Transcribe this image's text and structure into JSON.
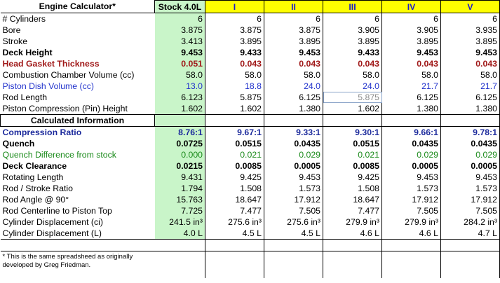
{
  "header": {
    "title": "Engine Calculator*",
    "stock": "Stock 4.0L",
    "cols": [
      "I",
      "II",
      "III",
      "IV",
      "V"
    ]
  },
  "rows": [
    {
      "label": "# Cylinders",
      "vals": [
        "6",
        "6",
        "6",
        "6",
        "6",
        "6"
      ]
    },
    {
      "label": "Bore",
      "vals": [
        "3.875",
        "3.875",
        "3.875",
        "3.905",
        "3.905",
        "3.935"
      ]
    },
    {
      "label": "Stroke",
      "vals": [
        "3.413",
        "3.895",
        "3.895",
        "3.895",
        "3.895",
        "3.895"
      ]
    },
    {
      "label": "Deck Height",
      "vals": [
        "9.453",
        "9.433",
        "9.453",
        "9.433",
        "9.453",
        "9.453"
      ]
    },
    {
      "label": "Head Gasket Thickness",
      "vals": [
        "0.051",
        "0.043",
        "0.043",
        "0.043",
        "0.043",
        "0.043"
      ]
    },
    {
      "label": "Combustion Chamber Volume (cc)",
      "vals": [
        "58.0",
        "58.0",
        "58.0",
        "58.0",
        "58.0",
        "58.0"
      ]
    },
    {
      "label": "Piston Dish Volume (cc)",
      "vals": [
        "13.0",
        "18.8",
        "24.0",
        "24.0",
        "21.7",
        "21.7"
      ]
    },
    {
      "label": "Rod Length",
      "vals": [
        "6.123",
        "5.875",
        "6.125",
        "5.875",
        "6.125",
        "6.125"
      ]
    },
    {
      "label": "Piston Compression (Pin) Height",
      "vals": [
        "1.602",
        "1.602",
        "1.380",
        "1.602",
        "1.380",
        "1.380"
      ]
    }
  ],
  "section_title": "Calculated Information",
  "calc_rows": [
    {
      "label": "Compression Ratio",
      "vals": [
        "8.76:1",
        "9.67:1",
        "9.33:1",
        "9.30:1",
        "9.66:1",
        "9.78:1"
      ]
    },
    {
      "label": "Quench",
      "vals": [
        "0.0725",
        "0.0515",
        "0.0435",
        "0.0515",
        "0.0435",
        "0.0435"
      ]
    },
    {
      "label": "Quench Difference from stock",
      "vals": [
        "0.000",
        "0.021",
        "0.029",
        "0.021",
        "0.029",
        "0.029"
      ]
    },
    {
      "label": "Deck Clearance",
      "vals": [
        "0.0215",
        "0.0085",
        "0.0005",
        "0.0085",
        "0.0005",
        "0.0005"
      ]
    },
    {
      "label": "Rotating Length",
      "vals": [
        "9.431",
        "9.425",
        "9.453",
        "9.425",
        "9.453",
        "9.453"
      ]
    },
    {
      "label": "Rod / Stroke Ratio",
      "vals": [
        "1.794",
        "1.508",
        "1.573",
        "1.508",
        "1.573",
        "1.573"
      ]
    },
    {
      "label": "Rod Angle @ 90°",
      "vals": [
        "15.763",
        "18.647",
        "17.912",
        "18.647",
        "17.912",
        "17.912"
      ]
    },
    {
      "label": "Rod Centerline to Piston Top",
      "vals": [
        "7.725",
        "7.477",
        "7.505",
        "7.477",
        "7.505",
        "7.505"
      ]
    },
    {
      "label": "Cylinder Displacement (ci)",
      "vals": [
        "241.5 in³",
        "275.6 in³",
        "275.6 in³",
        "279.9 in³",
        "279.9 in³",
        "284.2 in³"
      ]
    },
    {
      "label": "Cylinder Displacement (L)",
      "vals": [
        "4.0 L",
        "4.5 L",
        "4.5 L",
        "4.6 L",
        "4.6 L",
        "4.7 L"
      ]
    }
  ],
  "footnote": "* This is the same spreadsheed as originally developed by Greg Friedman."
}
